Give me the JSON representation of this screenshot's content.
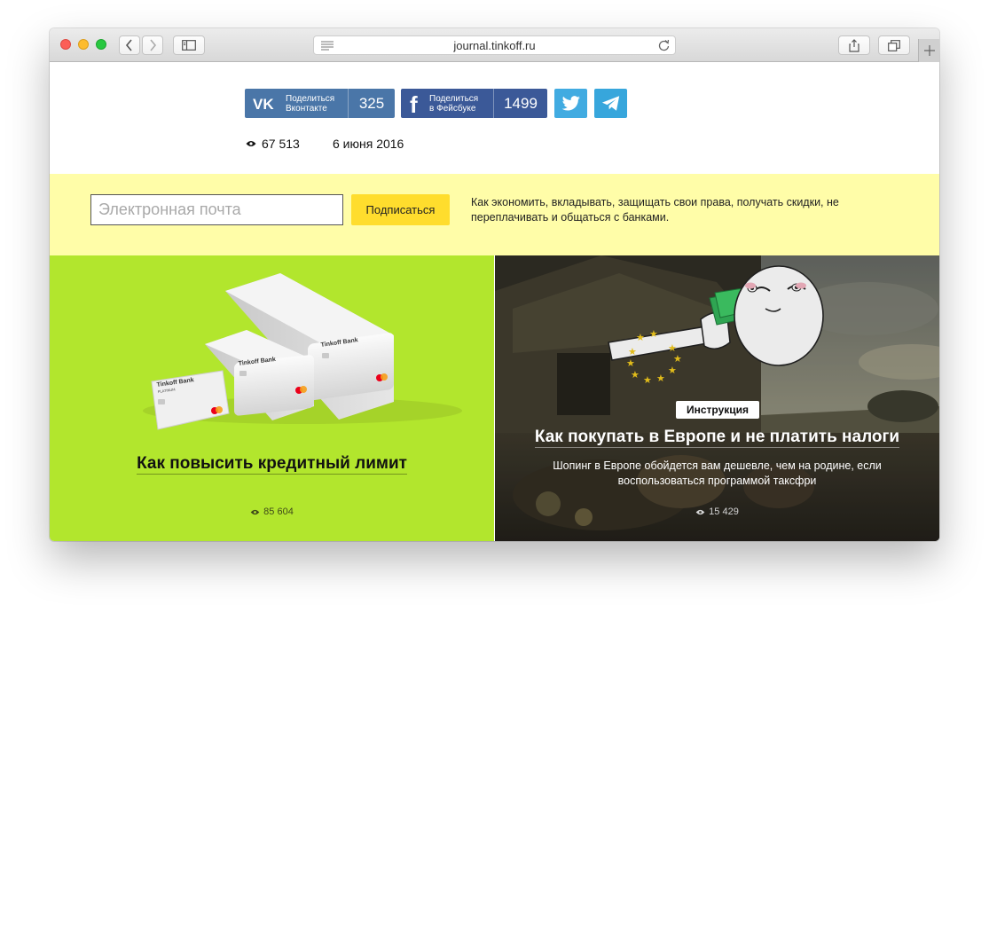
{
  "browser": {
    "url": "journal.tinkoff.ru"
  },
  "share": {
    "vk": {
      "label_line1": "Поделиться",
      "label_line2": "Вконтакте",
      "count": "325"
    },
    "fb": {
      "label_line1": "Поделиться",
      "label_line2": "в Фейсбуке",
      "count": "1499"
    }
  },
  "article": {
    "views": "67 513",
    "date": "6 июня 2016"
  },
  "subscribe": {
    "placeholder": "Электронная почта",
    "button": "Подписаться",
    "description": "Как экономить, вкладывать, защищать свои права, получать скидки, не переплачивать и общаться с банками."
  },
  "cards": [
    {
      "title": "Как повысить кредитный лимит",
      "views": "85 604",
      "bg_color": "#b2e62d",
      "card_brand": "Tinkoff Bank",
      "card_tier": "PLATINUM"
    },
    {
      "badge": "Инструкция",
      "title": "Как покупать в Европе и не платить налоги",
      "subtitle": "Шопинг в Европе обойдется вам дешевле, чем на родине, если воспользоваться программой таксфри",
      "views": "15 429"
    }
  ],
  "colors": {
    "vk": "#4a76a8",
    "facebook": "#3b5998",
    "twitter": "#41abe1",
    "telegram": "#37a6dc",
    "subscribe_bg": "#fffda8",
    "subscribe_button": "#ffdd2d"
  },
  "icons": [
    "vk-icon",
    "facebook-icon",
    "twitter-icon",
    "telegram-icon",
    "eye-icon",
    "back-icon",
    "forward-icon",
    "sidebar-icon",
    "share-icon",
    "tabs-icon",
    "reload-icon",
    "reader-icon",
    "plus-icon"
  ]
}
